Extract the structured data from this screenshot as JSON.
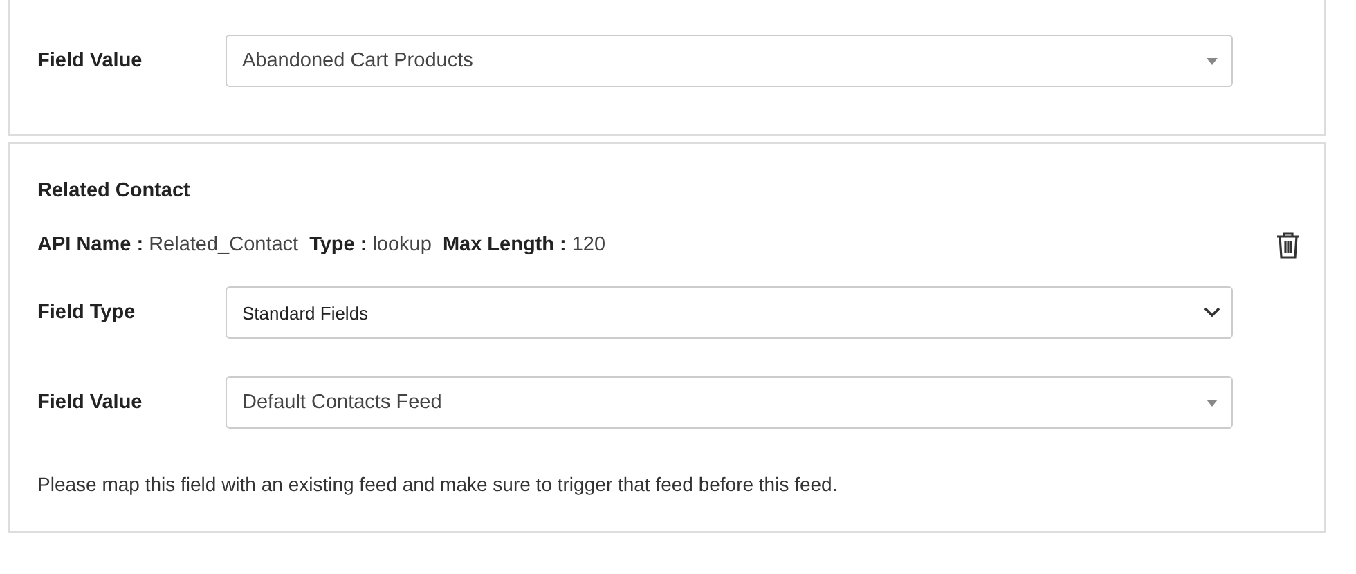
{
  "cards": [
    {
      "rows": [
        {
          "label": "Field Value",
          "kind": "dropdown",
          "value": "Abandoned Cart Products"
        }
      ]
    },
    {
      "title": "Related Contact",
      "meta": [
        {
          "label": "API Name :",
          "value": "Related_Contact"
        },
        {
          "label": "Type :",
          "value": "lookup"
        },
        {
          "label": "Max Length :",
          "value": "120"
        }
      ],
      "rows": [
        {
          "label": "Field Type",
          "kind": "select",
          "value": "Standard Fields"
        },
        {
          "label": "Field Value",
          "kind": "dropdown",
          "value": "Default Contacts Feed"
        }
      ],
      "note": "Please map this field with an existing feed and make sure to trigger that feed before this feed."
    }
  ]
}
